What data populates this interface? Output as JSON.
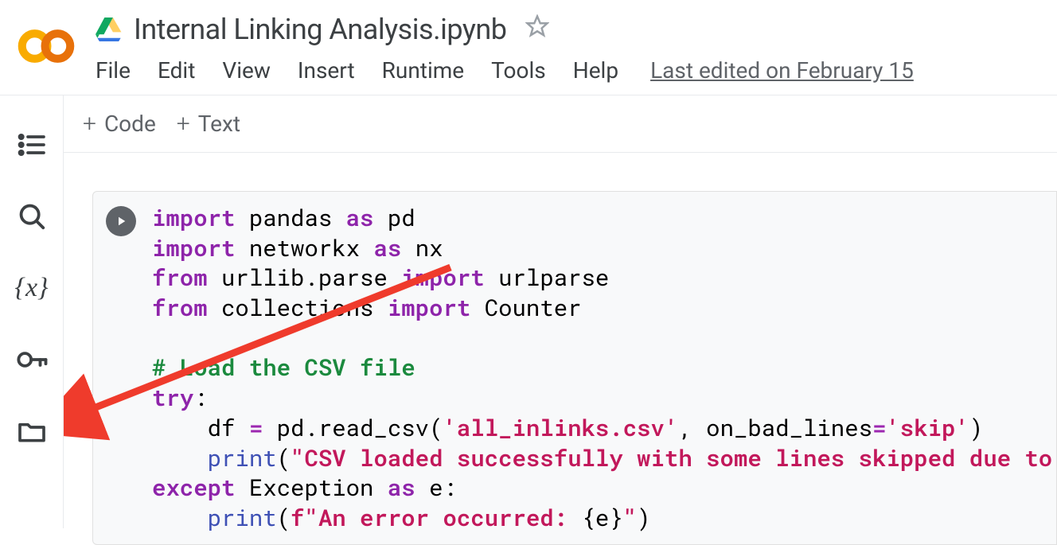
{
  "header": {
    "title": "Internal Linking Analysis.ipynb",
    "menu": {
      "file": "File",
      "edit": "Edit",
      "view": "View",
      "insert": "Insert",
      "runtime": "Runtime",
      "tools": "Tools",
      "help": "Help"
    },
    "last_edited": "Last edited on February 15"
  },
  "toolbar": {
    "code_label": "Code",
    "text_label": "Text"
  },
  "code": {
    "l1_import": "import",
    "l1_pandas": "pandas",
    "l1_as": "as",
    "l1_pd": "pd",
    "l2_import": "import",
    "l2_networkx": "networkx",
    "l2_as": "as",
    "l2_nx": "nx",
    "l3_from": "from",
    "l3_urllib": "urllib.parse",
    "l3_import": "import",
    "l3_urlparse": "urlparse",
    "l4_from": "from",
    "l4_collections": "collections",
    "l4_import": "import",
    "l4_counter": "Counter",
    "l6_comment": "# Load the CSV file",
    "l7_try": "try",
    "l7_colon": ":",
    "l8_df": "    df ",
    "l8_eq": "=",
    "l8_pd": " pd",
    "l8_dot1": ".",
    "l8_read": "read_csv",
    "l8_p1": "(",
    "l8_file": "'all_inlinks.csv'",
    "l8_comma": ", on_bad_lines",
    "l8_eq2": "=",
    "l8_skip": "'skip'",
    "l8_p2": ")",
    "l9_sp": "    ",
    "l9_print": "print",
    "l9_p1": "(",
    "l9_msg": "\"CSV loaded successfully with some lines skipped due to",
    "l10_except": "except",
    "l10_exception": " Exception ",
    "l10_as": "as",
    "l10_e": " e",
    "l10_colon": ":",
    "l11_sp": "    ",
    "l11_print": "print",
    "l11_p1": "(",
    "l11_f": "f\"An error occurred: ",
    "l11_brace1": "{",
    "l11_e": "e",
    "l11_brace2": "}",
    "l11_q": "\"",
    "l11_p2": ")"
  }
}
